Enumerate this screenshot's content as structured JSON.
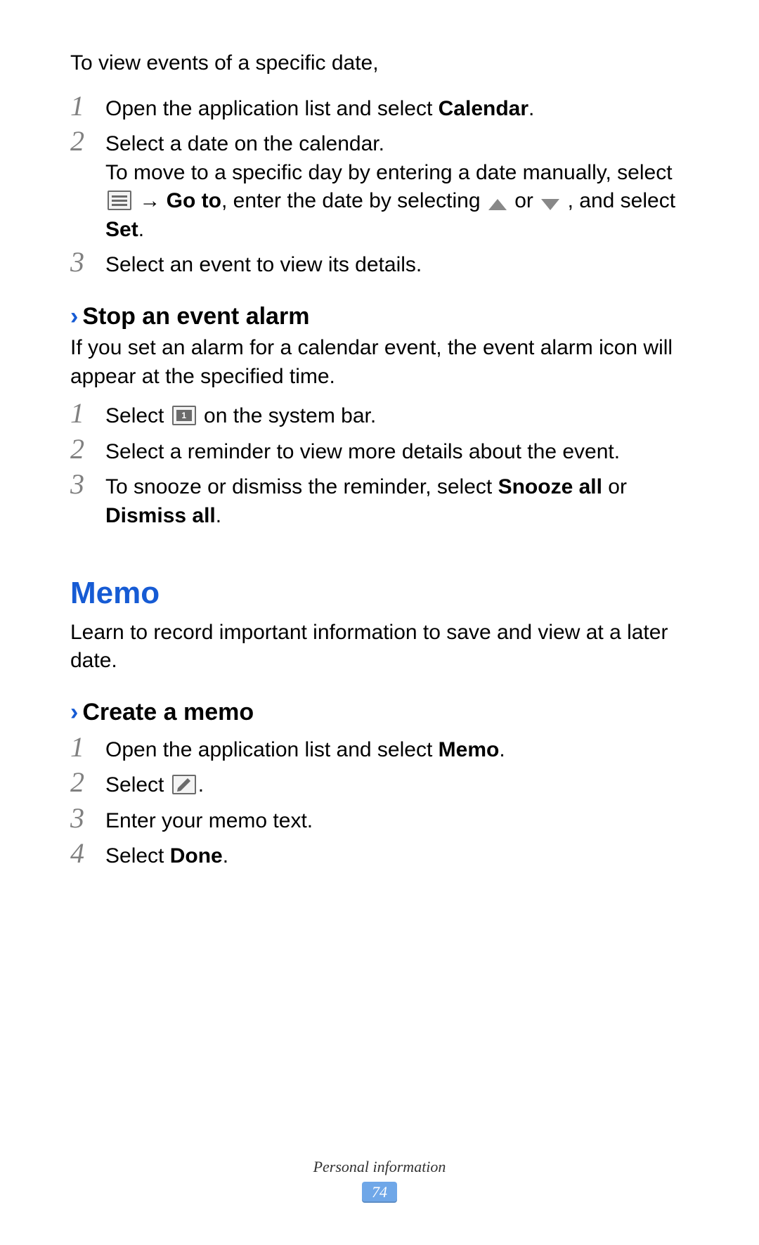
{
  "intro": "To view events of a specific date,",
  "list1": {
    "step1": {
      "pre": "Open the application list and select ",
      "bold": "Calendar",
      "post": "."
    },
    "step2": {
      "line1": "Select a date on the calendar.",
      "line2_a": "To move to a specific day by entering a date manually, select ",
      "arrow": " → ",
      "goto": "Go to",
      "line2_b": ", enter the date by selecting ",
      "or": " or ",
      "comma": " ,",
      "line2_c": "and select ",
      "set": "Set",
      "period": "."
    },
    "step3": "Select an event to view its details."
  },
  "sub1": "Stop an event alarm",
  "sub1_para": "If you set an alarm for a calendar event, the event alarm icon will appear at the specified time.",
  "list2": {
    "step1_a": "Select ",
    "step1_b": " on the system bar.",
    "step2": "Select a reminder to view more details about the event.",
    "step3_a": "To snooze or dismiss the reminder, select ",
    "snooze": "Snooze all",
    "or": " or ",
    "dismiss": "Dismiss all",
    "period": "."
  },
  "heading2": "Memo",
  "memo_para": "Learn to record important information to save and view at a later date.",
  "sub2": "Create a memo",
  "list3": {
    "step1_a": "Open the application list and select ",
    "memo": "Memo",
    "period": ".",
    "step2_a": "Select ",
    "step2_b": ".",
    "step3": "Enter your memo text.",
    "step4_a": "Select ",
    "done": "Done",
    "step4_b": "."
  },
  "footer": {
    "label": "Personal information",
    "page": "74"
  },
  "notif_badge": "1"
}
